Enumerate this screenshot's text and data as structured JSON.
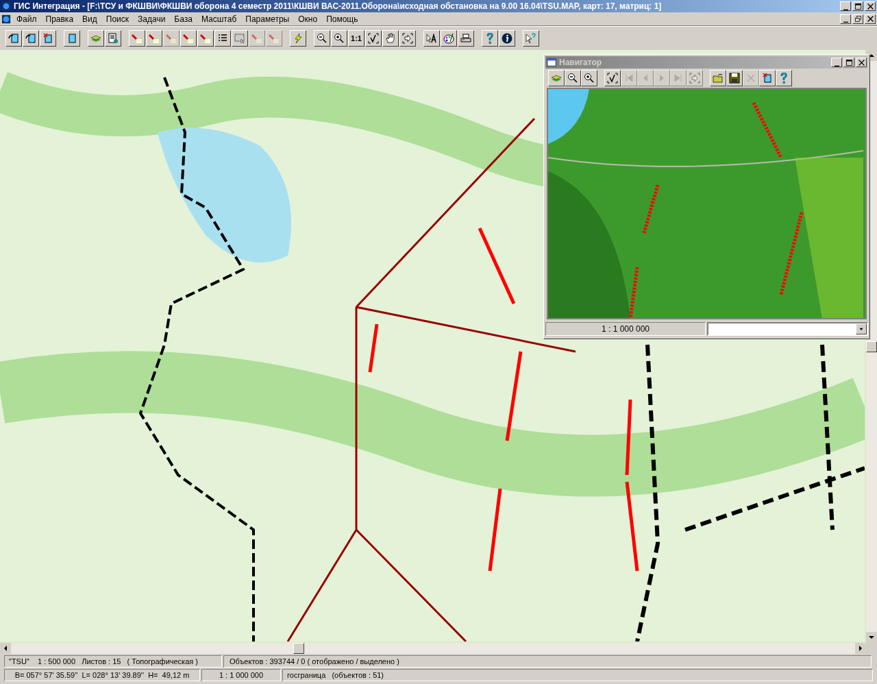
{
  "window": {
    "title": "ГИС Интеграция - [F:\\ТСУ и ФКШВИ\\ФКШВИ оборона 4 семестр 2011\\КШВИ ВАС-2011.Оборона\\исходная обстановка на 9.00  16.04\\TSU.MAP, карт: 17, матриц: 1]"
  },
  "menu": [
    "Файл",
    "Правка",
    "Вид",
    "Поиск",
    "Задачи",
    "База",
    "Масштаб",
    "Параметры",
    "Окно",
    "Помощь"
  ],
  "toolbar": {
    "groups": [
      [
        {
          "disabled": false
        },
        {
          "disabled": false
        },
        {
          "disabled": false
        }
      ],
      [
        {
          "disabled": false
        }
      ],
      [
        {
          "disabled": false
        },
        {
          "disabled": false
        }
      ],
      [
        {
          "disabled": false
        },
        {
          "disabled": false
        },
        {
          "disabled": true
        },
        {
          "disabled": false
        },
        {
          "disabled": false
        },
        {
          "disabled": false
        },
        {
          "disabled": false
        },
        {
          "disabled": true
        },
        {
          "disabled": true
        }
      ],
      [
        {
          "disabled": false
        }
      ],
      [
        {
          "disabled": false
        },
        {
          "disabled": false
        },
        {
          "disabled": false,
          "label": "1:1"
        },
        {
          "disabled": false
        },
        {
          "disabled": false
        },
        {
          "disabled": false
        }
      ],
      [
        {
          "disabled": false
        },
        {
          "disabled": false
        },
        {
          "disabled": false
        }
      ],
      [
        {
          "disabled": false
        },
        {
          "disabled": false
        }
      ],
      [
        {
          "disabled": false
        }
      ]
    ]
  },
  "navigator": {
    "title": "Навигатор",
    "toolbar": {
      "groups": [
        [
          {
            "disabled": false
          },
          {
            "disabled": false
          },
          {
            "disabled": false
          }
        ],
        [
          {
            "disabled": false
          },
          {
            "disabled": true
          },
          {
            "disabled": true
          },
          {
            "disabled": true
          },
          {
            "disabled": true
          },
          {
            "disabled": true
          }
        ],
        [
          {
            "disabled": false
          },
          {
            "disabled": false
          },
          {
            "disabled": true
          },
          {
            "disabled": false
          },
          {
            "disabled": false
          }
        ]
      ]
    },
    "scale": "1 : 1 000 000"
  },
  "status_bar": {
    "row_1": [
      "\"TSU\"    1 : 500 000   Листов : 15   ( Топографическая )",
      "Объектов : 393744 / 0 ( отображено / выделено )"
    ],
    "row_2": [
      "B= 057° 57' 35.59''  L= 028° 13' 39.89''  H=  49,12 m",
      "1 : 1 000 000",
      "госграница   (объектов : 51)"
    ]
  }
}
